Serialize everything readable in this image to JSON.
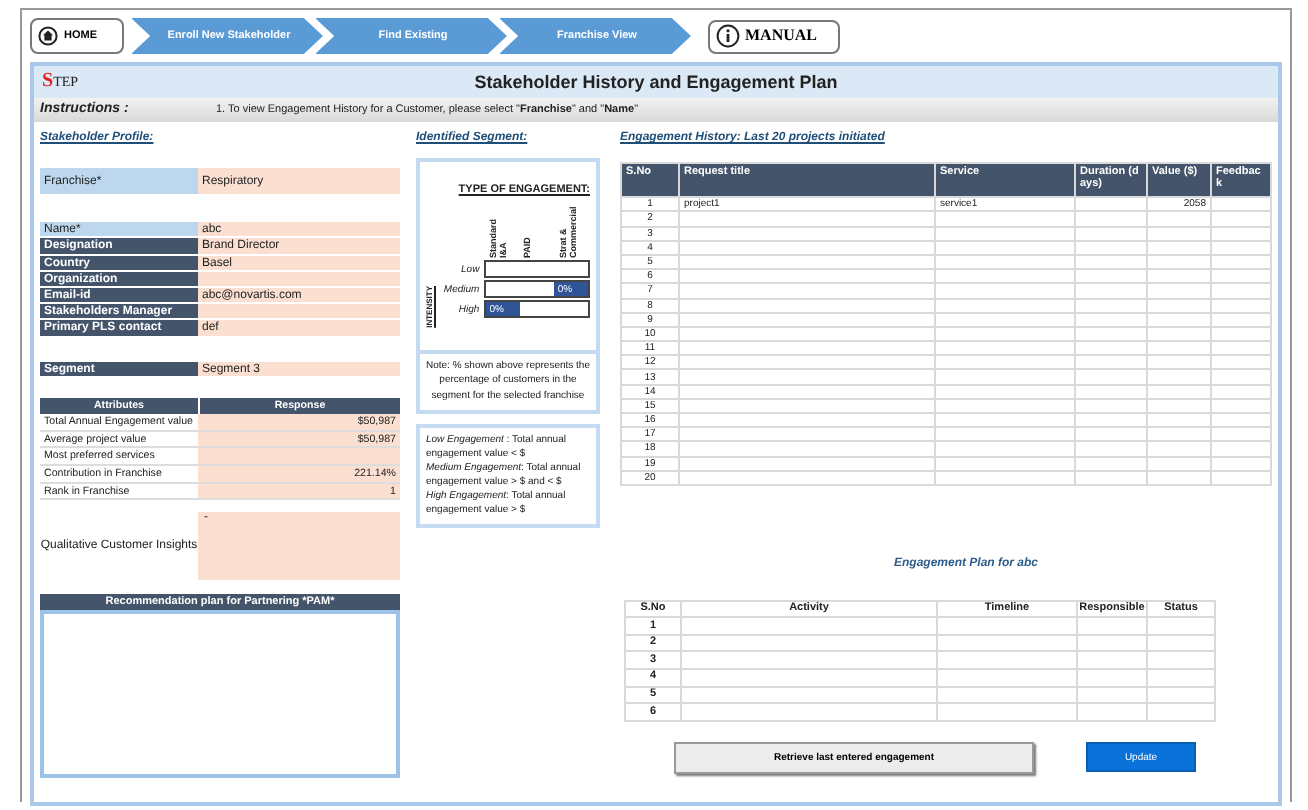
{
  "nav": {
    "home": "HOME",
    "steps": [
      "Enroll New Stakeholder",
      "Find Existing",
      "Franchise View"
    ],
    "manual": "MANUAL"
  },
  "logo": {
    "initial": "S",
    "rest": "TEP"
  },
  "title": "Stakeholder History and Engagement Plan",
  "instructions": {
    "label": "Instructions :",
    "text": "1. To view Engagement History for a Customer, please select \"**Franchise**\" and \"**Name**\""
  },
  "profile": {
    "heading": "Stakeholder Profile:",
    "franchise": {
      "label": "Franchise*",
      "value": "Respiratory"
    },
    "fields": [
      {
        "label": "Name*",
        "value": "abc",
        "kind": "key"
      },
      {
        "label": "Designation",
        "value": "Brand Director",
        "kind": "header"
      },
      {
        "label": "Country",
        "value": "Basel",
        "kind": "header"
      },
      {
        "label": "Organization",
        "kind": "header"
      },
      {
        "label": "Email-id",
        "value": "abc@novartis.com",
        "kind": "header"
      },
      {
        "label": "Stakeholders Manager",
        "kind": "header"
      },
      {
        "label": "Primary PLS contact",
        "value": "def",
        "kind": "header"
      }
    ],
    "segment": {
      "label": "Segment",
      "value": "Segment 3"
    },
    "attributes": {
      "columns": [
        "Attributes",
        "Response"
      ],
      "rows": [
        {
          "label": "Total Annual Engagement value",
          "value": "$50,987"
        },
        {
          "label": "Average project value",
          "value": "$50,987"
        },
        {
          "label": "Most preferred services"
        },
        {
          "label": "Contribution in Franchise",
          "value": "221.14%"
        },
        {
          "label": "Rank in Franchise",
          "value": "1"
        }
      ]
    },
    "insights": {
      "label": "Qualitative Customer Insights",
      "value": "-"
    },
    "recommendation": {
      "heading": "Recommendation plan for Partnering *PAM*"
    }
  },
  "segment_panel": {
    "heading": "Identified Segment:",
    "matrix": {
      "title": "TYPE OF ENGAGEMENT:",
      "axis_label": "INTENSITY",
      "columns": [
        "Standard I&A",
        "PAID",
        "Strat & Commercial"
      ],
      "rows": [
        {
          "label": "Low",
          "cells": [
            {
              "filled": false
            },
            {
              "filled": false
            },
            {
              "filled": false
            }
          ]
        },
        {
          "label": "Medium",
          "cells": [
            {
              "filled": false
            },
            {
              "filled": false
            },
            {
              "filled": true,
              "text": "0%"
            }
          ]
        },
        {
          "label": "High",
          "cells": [
            {
              "filled": true,
              "text": "0%"
            },
            {
              "filled": false
            },
            {
              "filled": false
            }
          ]
        }
      ]
    },
    "note": "Note: % shown above represents the percentage of customers in the segment for the selected franchise",
    "legend": [
      "*Low Engagement* : Total annual engagement value < $",
      "*Medium Engagement*: Total annual engagement value > $            and < $",
      "*High Engagement*:  Total annual engagement value > $"
    ]
  },
  "history": {
    "heading": "Engagement History: Last 20 projects initiated",
    "columns": [
      "S.No",
      "Request title",
      "Service",
      "Duration (days)",
      "Value ($)",
      "Feedback"
    ],
    "rows": [
      {
        "no": "1",
        "title": "project1",
        "service": "service1",
        "value": "2058"
      },
      {
        "no": "2"
      },
      {
        "no": "3"
      },
      {
        "no": "4"
      },
      {
        "no": "5"
      },
      {
        "no": "6"
      },
      {
        "no": "7"
      },
      {
        "no": "8"
      },
      {
        "no": "9"
      },
      {
        "no": "10"
      },
      {
        "no": "11"
      },
      {
        "no": "12"
      },
      {
        "no": "13"
      },
      {
        "no": "14"
      },
      {
        "no": "15"
      },
      {
        "no": "16"
      },
      {
        "no": "17"
      },
      {
        "no": "18"
      },
      {
        "no": "19"
      },
      {
        "no": "20"
      }
    ]
  },
  "plan": {
    "heading": "Engagement Plan for abc",
    "columns": [
      "S.No",
      "Activity",
      "Timeline",
      "Responsible",
      "Status"
    ],
    "rows": [
      {
        "no": "1"
      },
      {
        "no": "2"
      },
      {
        "no": "3"
      },
      {
        "no": "4"
      },
      {
        "no": "5"
      },
      {
        "no": "6"
      }
    ]
  },
  "buttons": [
    {
      "label": "Retrieve last entered engagement",
      "kind": "secondary"
    },
    {
      "label": "Update",
      "kind": "primary"
    }
  ]
}
